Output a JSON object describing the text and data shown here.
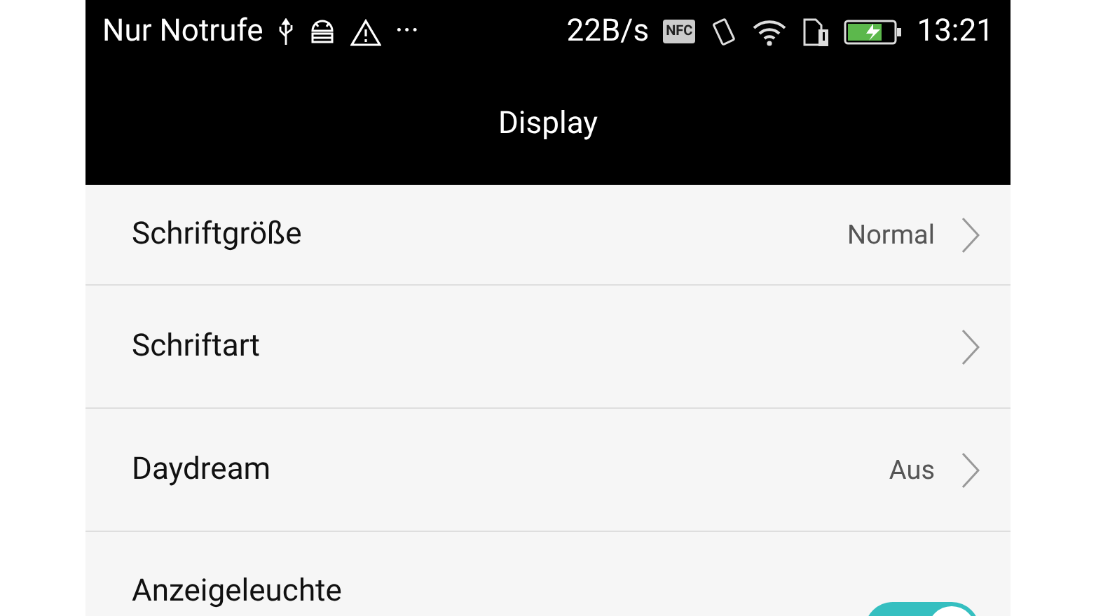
{
  "status_bar": {
    "carrier": "Nur Notrufe",
    "more": "···",
    "speed": "22B/s",
    "nfc": "NFC",
    "time": "13:21"
  },
  "header": {
    "title": "Display"
  },
  "rows": [
    {
      "kind": "link",
      "label": "Schriftgröße",
      "value": "Normal"
    },
    {
      "kind": "link",
      "label": "Schriftart"
    },
    {
      "kind": "link",
      "label": "Daydream",
      "value": "Aus"
    },
    {
      "kind": "toggle",
      "label": "Anzeigeleuchte",
      "on": true
    }
  ]
}
